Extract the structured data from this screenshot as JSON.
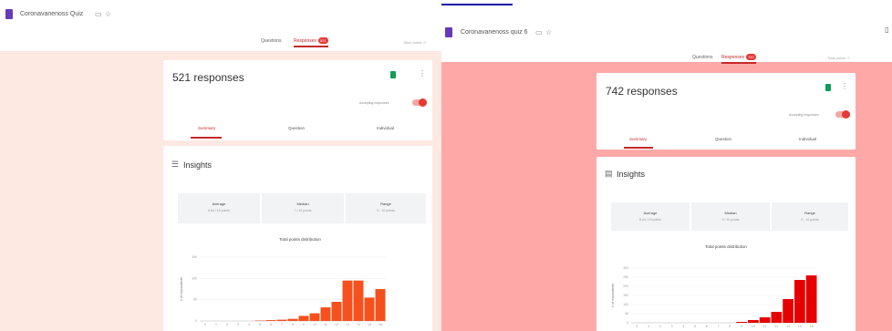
{
  "panels": [
    {
      "form_title": "Coronavanenoss Quiz",
      "tabs": [
        {
          "label": "Questions",
          "active": false
        },
        {
          "label": "Responses",
          "active": true,
          "badge": "521"
        },
        {
          "label": "Total points: 0",
          "active": false
        }
      ],
      "responses_count": "521 responses",
      "accepting_label": "Accepting responses",
      "sub_tabs": [
        {
          "label": "Summary",
          "active": true
        },
        {
          "label": "Question",
          "active": false
        },
        {
          "label": "Individual",
          "active": false
        }
      ],
      "insights": {
        "title": "Insights",
        "stats": [
          {
            "label": "Average",
            "value": "6.84 / 10 points"
          },
          {
            "label": "Median",
            "value": "7 / 10 points"
          },
          {
            "label": "Range",
            "value": "0 - 10 points"
          }
        ]
      },
      "chart_data": {
        "type": "bar",
        "title": "Total points distribution",
        "ylabel": "# of respondents",
        "ylim": [
          0,
          150
        ],
        "yticks": [
          0,
          50,
          100,
          150
        ],
        "categories": [
          "0",
          "1",
          "2",
          "3",
          "4",
          "5",
          "6",
          "7",
          "8",
          "9",
          "10",
          "11",
          "12",
          "13",
          "14",
          "15",
          "16"
        ],
        "values": [
          0,
          0,
          0,
          0,
          0,
          1,
          2,
          3,
          5,
          12,
          18,
          32,
          45,
          95,
          95,
          55,
          75
        ],
        "bar_color": "#f4511e"
      },
      "colors": {
        "background": "#fde8e2"
      }
    },
    {
      "form_title": "Coronavanenoss quiz 6",
      "tabs": [
        {
          "label": "Questions",
          "active": false
        },
        {
          "label": "Responses",
          "active": true,
          "badge": "742"
        },
        {
          "label": "Total points: 0",
          "active": false
        }
      ],
      "responses_count": "742 responses",
      "accepting_label": "Accepting responses",
      "sub_tabs": [
        {
          "label": "Summary",
          "active": true
        },
        {
          "label": "Question",
          "active": false
        },
        {
          "label": "Individual",
          "active": false
        }
      ],
      "insights": {
        "title": "Insights",
        "stats": [
          {
            "label": "Average",
            "value": "8.44 / 10 points"
          },
          {
            "label": "Median",
            "value": "9 / 10 points"
          },
          {
            "label": "Range",
            "value": "0 - 10 points"
          }
        ]
      },
      "chart_data": {
        "type": "bar",
        "title": "Total points distribution",
        "ylabel": "# of respondents",
        "ylim": [
          0,
          300
        ],
        "yticks": [
          0,
          50,
          100,
          150,
          200,
          250,
          300
        ],
        "categories": [
          "0",
          "1",
          "2",
          "3",
          "4",
          "5",
          "6",
          "7",
          "8",
          "9",
          "10",
          "11",
          "12",
          "13",
          "14",
          "15"
        ],
        "values": [
          0,
          0,
          0,
          0,
          0,
          0,
          0,
          0,
          0,
          5,
          15,
          30,
          60,
          130,
          235,
          260
        ],
        "bar_color": "#e60000"
      },
      "colors": {
        "background": "#ffa8a8"
      }
    }
  ]
}
